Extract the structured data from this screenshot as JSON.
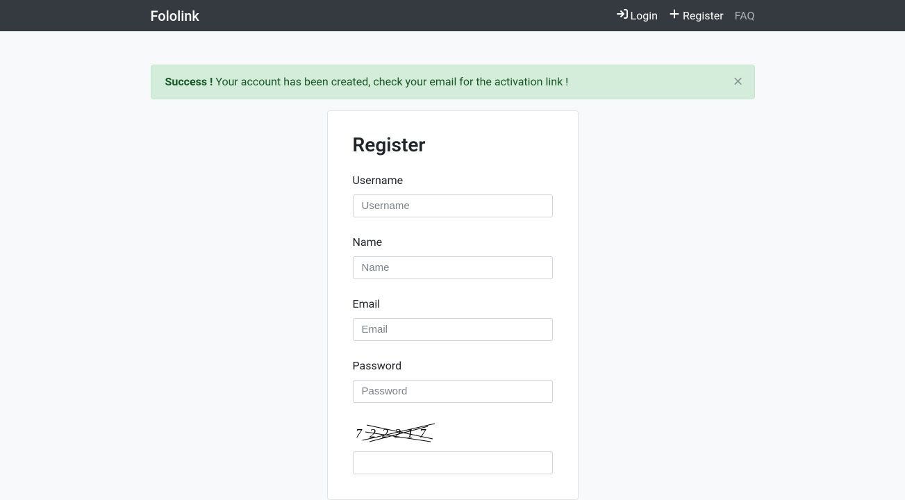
{
  "navbar": {
    "brand": "Fololink",
    "login": "Login",
    "register": "Register",
    "faq": "FAQ"
  },
  "alert": {
    "strong": "Success !",
    "message": " Your account has been created, check your email for the activation link !",
    "close_glyph": "×"
  },
  "form": {
    "title": "Register",
    "username_label": "Username",
    "username_placeholder": "Username",
    "name_label": "Name",
    "name_placeholder": "Name",
    "email_label": "Email",
    "email_placeholder": "Email",
    "password_label": "Password",
    "password_placeholder": "Password"
  },
  "captcha": {
    "digits": [
      "7",
      "2",
      "2",
      "2",
      "1",
      "7"
    ]
  }
}
